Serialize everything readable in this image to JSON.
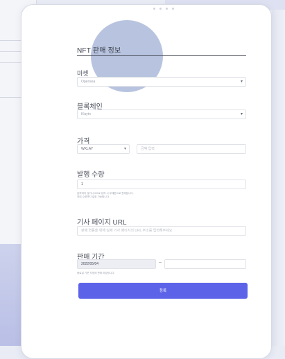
{
  "form": {
    "title": "NFT 판매 정보",
    "market": {
      "label": "마켓",
      "value": "Opensea"
    },
    "blockchain": {
      "label": "블록체인",
      "value": "Klaytn"
    },
    "price": {
      "label": "가격",
      "currency": "WKLAY",
      "placeholder": "금액 입력"
    },
    "supply": {
      "label": "발행 수량",
      "value": "1",
      "help": [
        "입력하지 않거나 0으로 입력 시 무제한으로 판매됩니다.",
        "최대 수량까지 설정 가능합니다."
      ]
    },
    "article_url": {
      "label": "기사 페이지 URL",
      "placeholder": "판매 연동을 위해 실제 기사 페이지의 URL 주소를 입력해주세요"
    },
    "period": {
      "label": "판매 기간",
      "start": "2022/05/04",
      "separator": "~",
      "end": "",
      "help": "종료일 기준 자정에 판매 마감됩니다."
    },
    "submit_label": "등록"
  }
}
